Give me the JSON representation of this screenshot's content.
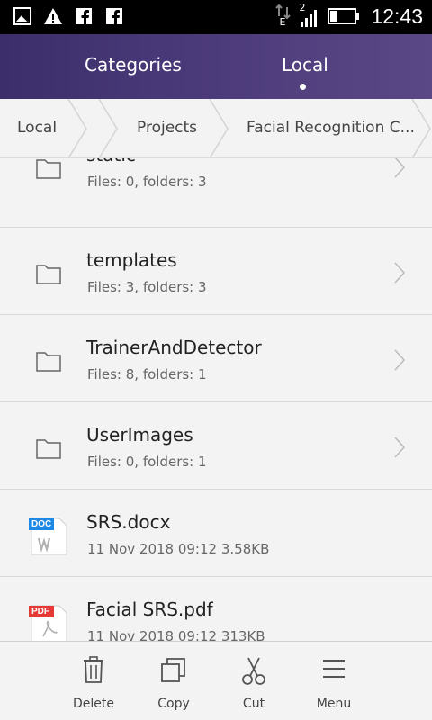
{
  "status_bar": {
    "time": "12:43",
    "network_label": "E",
    "sim_label": "2",
    "icons": [
      "gallery-icon",
      "warning-icon",
      "facebook-icon",
      "facebook-icon",
      "data-arrows-icon",
      "signal-icon",
      "battery-icon"
    ]
  },
  "tabs": [
    {
      "label": "Categories",
      "active": false
    },
    {
      "label": "Local",
      "active": true
    }
  ],
  "breadcrumb": [
    "Local",
    "Projects",
    "Facial Recognition C..."
  ],
  "items": [
    {
      "type": "folder",
      "name": "static",
      "detail": "Files: 0, folders: 3"
    },
    {
      "type": "folder",
      "name": "templates",
      "detail": "Files: 3, folders: 3"
    },
    {
      "type": "folder",
      "name": "TrainerAndDetector",
      "detail": "Files: 8, folders: 1"
    },
    {
      "type": "folder",
      "name": "UserImages",
      "detail": "Files: 0, folders: 1"
    },
    {
      "type": "doc",
      "name": "SRS.docx",
      "detail": "11 Nov 2018 09:12 3.58KB",
      "badge": "DOC",
      "badge_color": "#1e88e5"
    },
    {
      "type": "pdf",
      "name": "Facial SRS.pdf",
      "detail": "11 Nov 2018 09:12 313KB",
      "badge": "PDF",
      "badge_color": "#e53935"
    }
  ],
  "bottom_actions": [
    {
      "label": "Delete",
      "icon": "trash-icon"
    },
    {
      "label": "Copy",
      "icon": "copy-icon"
    },
    {
      "label": "Cut",
      "icon": "scissors-icon"
    },
    {
      "label": "Menu",
      "icon": "menu-icon"
    }
  ],
  "colors": {
    "header_start": "#3b2e6a",
    "header_end": "#5a4785",
    "background": "#f3f3f3"
  }
}
